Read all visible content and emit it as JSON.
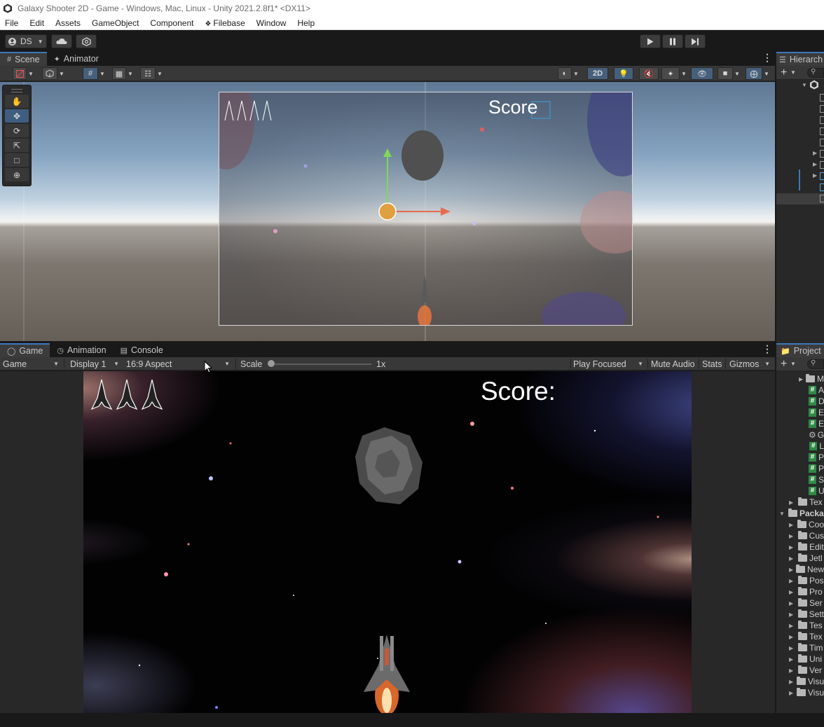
{
  "window": {
    "title": "Galaxy Shooter 2D - Game - Windows, Mac, Linux - Unity 2021.2.8f1* <DX11>"
  },
  "menu": [
    "File",
    "Edit",
    "Assets",
    "GameObject",
    "Component",
    "Filebase",
    "Window",
    "Help"
  ],
  "toolbar": {
    "account": "DS"
  },
  "scene_panel": {
    "tabs": [
      "Scene",
      "Animator"
    ],
    "mode_2d": "2D",
    "hud_score": "Score"
  },
  "game_panel": {
    "tabs": [
      "Game",
      "Animation",
      "Console"
    ],
    "view_mode": "Game",
    "display": "Display 1",
    "aspect": "16:9 Aspect",
    "scale_label": "Scale",
    "scale_value": "1x",
    "scale_level": 0,
    "play_focused": "Play Focused",
    "mute_audio": "Mute Audio",
    "stats": "Stats",
    "gizmos": "Gizmos",
    "score": "Score:"
  },
  "hierarchy": {
    "title": "Hierarch"
  },
  "project": {
    "title": "Project",
    "rows": [
      {
        "icon": "folder",
        "label": "M"
      },
      {
        "icon": "script",
        "label": "A"
      },
      {
        "icon": "script",
        "label": "D"
      },
      {
        "icon": "script",
        "label": "E"
      },
      {
        "icon": "script",
        "label": "E"
      },
      {
        "icon": "gear",
        "label": "G"
      },
      {
        "icon": "script",
        "label": "L"
      },
      {
        "icon": "script",
        "label": "P"
      },
      {
        "icon": "script",
        "label": "P"
      },
      {
        "icon": "script",
        "label": "S"
      },
      {
        "icon": "script",
        "label": "U"
      },
      {
        "icon": "folder",
        "label": "Tex"
      },
      {
        "icon": "folder-open",
        "label": "Packa"
      },
      {
        "icon": "folder",
        "label": "Coo"
      },
      {
        "icon": "folder",
        "label": "Cus"
      },
      {
        "icon": "folder",
        "label": "Edit"
      },
      {
        "icon": "folder",
        "label": "Jetl"
      },
      {
        "icon": "folder",
        "label": "New"
      },
      {
        "icon": "folder",
        "label": "Pos"
      },
      {
        "icon": "folder",
        "label": "Pro"
      },
      {
        "icon": "folder",
        "label": "Ser"
      },
      {
        "icon": "folder",
        "label": "Sett"
      },
      {
        "icon": "folder",
        "label": "Tes"
      },
      {
        "icon": "folder",
        "label": "Tex"
      },
      {
        "icon": "folder",
        "label": "Tim"
      },
      {
        "icon": "folder",
        "label": "Uni"
      },
      {
        "icon": "folder",
        "label": "Ver"
      },
      {
        "icon": "folder",
        "label": "Visu"
      },
      {
        "icon": "folder",
        "label": "Visu"
      }
    ]
  },
  "colors": {
    "accent": "#3a79bb",
    "panel": "#282828",
    "tab_active": "#3c3c3c",
    "script_icon": "#2c8b44"
  }
}
